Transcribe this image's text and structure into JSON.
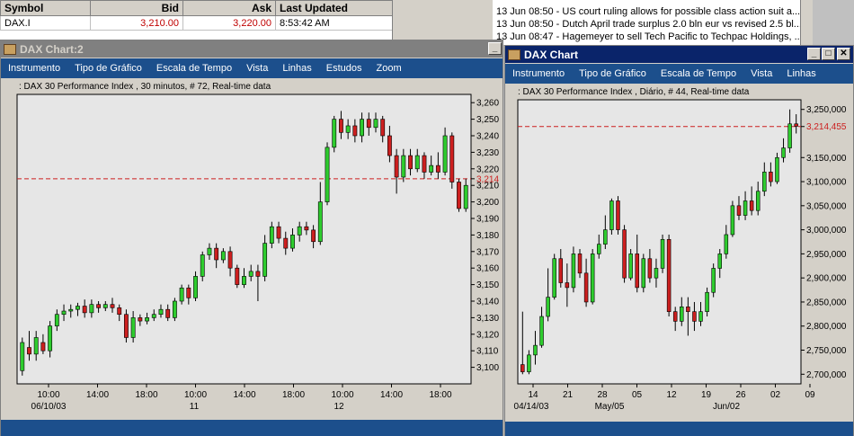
{
  "quotes": {
    "headers": {
      "symbol": "Symbol",
      "bid": "Bid",
      "ask": "Ask",
      "last_updated": "Last Updated"
    },
    "rows": [
      {
        "symbol": "DAX.I",
        "bid": "3,210.00",
        "ask": "3,220.00",
        "last_updated": "8:53:42 AM"
      }
    ]
  },
  "news": {
    "items": [
      "13 Jun 08:50 - US court ruling allows for possible class action suit a...",
      "13 Jun 08:50 - Dutch April trade surplus 2.0 bln eur vs revised 2.5 bl...",
      "13 Jun 08:47 - Hagemeyer to sell Tech Pacific to Techpac Holdings, ..."
    ]
  },
  "colors": {
    "menubar": "#1c4f8c",
    "up_candle": "#2ecc2e",
    "down_candle": "#cc1f1f",
    "last_line": "#cc1f1f"
  },
  "window_left": {
    "title": "DAX Chart:2",
    "menu": [
      "Instrumento",
      "Tipo de Gráfico",
      "Escala de Tempo",
      "Vista",
      "Linhas",
      "Estudos",
      "Zoom"
    ],
    "caption": ": DAX 30 Performance Index , 30 minutos, # 72, Real-time data",
    "chart_data": {
      "type": "candlestick",
      "ylim": [
        3090,
        3265
      ],
      "y_ticks": [
        "3,260",
        "3,250",
        "3,240",
        "3,230",
        "3,220",
        "3,214",
        "3,210",
        "3,200",
        "3,190",
        "3,180",
        "3,170",
        "3,160",
        "3,150",
        "3,140",
        "3,130",
        "3,120",
        "3,110",
        "3,100"
      ],
      "last_value": 3214,
      "last_label": "3,214",
      "x_tick_labels": [
        "10:00",
        "14:00",
        "18:00",
        "10:00",
        "14:00",
        "18:00",
        "10:00",
        "14:00",
        "18:00"
      ],
      "x_date_labels": [
        "06/10/03",
        "11",
        "12"
      ],
      "candles": [
        [
          3098,
          3115,
          3095,
          3118
        ],
        [
          3112,
          3108,
          3104,
          3122
        ],
        [
          3108,
          3118,
          3104,
          3122
        ],
        [
          3115,
          3110,
          3108,
          3120
        ],
        [
          3110,
          3125,
          3106,
          3128
        ],
        [
          3125,
          3132,
          3122,
          3135
        ],
        [
          3132,
          3134,
          3128,
          3138
        ],
        [
          3134,
          3135,
          3130,
          3138
        ],
        [
          3135,
          3137,
          3131,
          3139
        ],
        [
          3137,
          3133,
          3130,
          3141
        ],
        [
          3133,
          3138,
          3130,
          3141
        ],
        [
          3138,
          3136,
          3133,
          3140
        ],
        [
          3136,
          3138,
          3134,
          3140
        ],
        [
          3138,
          3136,
          3133,
          3142
        ],
        [
          3136,
          3132,
          3128,
          3138
        ],
        [
          3132,
          3118,
          3115,
          3135
        ],
        [
          3118,
          3130,
          3115,
          3134
        ],
        [
          3130,
          3128,
          3125,
          3132
        ],
        [
          3128,
          3130,
          3126,
          3133
        ],
        [
          3130,
          3132,
          3128,
          3135
        ],
        [
          3132,
          3135,
          3130,
          3138
        ],
        [
          3135,
          3130,
          3128,
          3138
        ],
        [
          3130,
          3140,
          3128,
          3142
        ],
        [
          3140,
          3148,
          3138,
          3150
        ],
        [
          3148,
          3142,
          3138,
          3150
        ],
        [
          3142,
          3155,
          3140,
          3158
        ],
        [
          3155,
          3168,
          3152,
          3170
        ],
        [
          3168,
          3172,
          3165,
          3175
        ],
        [
          3172,
          3165,
          3160,
          3175
        ],
        [
          3165,
          3170,
          3163,
          3172
        ],
        [
          3170,
          3160,
          3155,
          3173
        ],
        [
          3160,
          3150,
          3148,
          3162
        ],
        [
          3150,
          3155,
          3148,
          3160
        ],
        [
          3155,
          3158,
          3152,
          3162
        ],
        [
          3158,
          3155,
          3140,
          3162
        ],
        [
          3155,
          3175,
          3152,
          3180
        ],
        [
          3175,
          3185,
          3172,
          3188
        ],
        [
          3185,
          3178,
          3175,
          3188
        ],
        [
          3178,
          3172,
          3168,
          3182
        ],
        [
          3172,
          3180,
          3170,
          3184
        ],
        [
          3180,
          3185,
          3176,
          3188
        ],
        [
          3185,
          3183,
          3180,
          3188
        ],
        [
          3183,
          3176,
          3172,
          3186
        ],
        [
          3176,
          3200,
          3174,
          3212
        ],
        [
          3200,
          3233,
          3198,
          3236
        ],
        [
          3233,
          3250,
          3230,
          3252
        ],
        [
          3250,
          3242,
          3238,
          3255
        ],
        [
          3242,
          3246,
          3238,
          3250
        ],
        [
          3246,
          3240,
          3236,
          3250
        ],
        [
          3240,
          3250,
          3236,
          3254
        ],
        [
          3250,
          3245,
          3240,
          3254
        ],
        [
          3245,
          3250,
          3242,
          3254
        ],
        [
          3250,
          3240,
          3236,
          3252
        ],
        [
          3240,
          3228,
          3224,
          3246
        ],
        [
          3228,
          3215,
          3205,
          3232
        ],
        [
          3215,
          3228,
          3212,
          3232
        ],
        [
          3228,
          3220,
          3216,
          3232
        ],
        [
          3220,
          3228,
          3218,
          3232
        ],
        [
          3228,
          3218,
          3214,
          3230
        ],
        [
          3218,
          3222,
          3216,
          3228
        ],
        [
          3222,
          3218,
          3214,
          3230
        ],
        [
          3218,
          3240,
          3216,
          3245
        ],
        [
          3240,
          3212,
          3208,
          3242
        ],
        [
          3212,
          3196,
          3194,
          3214
        ],
        [
          3196,
          3210,
          3194,
          3214
        ]
      ]
    }
  },
  "window_right": {
    "title": "DAX Chart",
    "menu": [
      "Instrumento",
      "Tipo de Gráfico",
      "Escala de Tempo",
      "Vista",
      "Linhas"
    ],
    "caption": ": DAX 30 Performance Index , Diário, # 44, Real-time data",
    "chart_data": {
      "type": "candlestick",
      "ylim": [
        2680,
        3270
      ],
      "y_ticks": [
        "3,250,000",
        "3,214,455",
        "3,150,000",
        "3,100,000",
        "3,050,000",
        "3,000,000",
        "2,950,000",
        "2,900,000",
        "2,850,000",
        "2,800,000",
        "2,750,000",
        "2,700,000"
      ],
      "last_value": 3214.455,
      "last_label": "3,214,455",
      "x_tick_labels": [
        "14",
        "21",
        "28",
        "05",
        "12",
        "19",
        "26",
        "02",
        "09"
      ],
      "x_date_labels": [
        "04/14/03",
        "May/05",
        "Jun/02"
      ],
      "candles": [
        [
          2720,
          2705,
          2700,
          2830
        ],
        [
          2705,
          2740,
          2700,
          2750
        ],
        [
          2740,
          2760,
          2720,
          2790
        ],
        [
          2760,
          2820,
          2755,
          2840
        ],
        [
          2820,
          2860,
          2810,
          2920
        ],
        [
          2860,
          2940,
          2855,
          2950
        ],
        [
          2940,
          2890,
          2880,
          2960
        ],
        [
          2890,
          2880,
          2840,
          2930
        ],
        [
          2880,
          2950,
          2870,
          2965
        ],
        [
          2950,
          2910,
          2900,
          2960
        ],
        [
          2910,
          2850,
          2840,
          2940
        ],
        [
          2850,
          2950,
          2845,
          2960
        ],
        [
          2950,
          2970,
          2940,
          2990
        ],
        [
          2970,
          3000,
          2960,
          3030
        ],
        [
          3000,
          3060,
          2990,
          3065
        ],
        [
          3060,
          3000,
          2990,
          3070
        ],
        [
          3000,
          2900,
          2890,
          3010
        ],
        [
          2900,
          2950,
          2895,
          2960
        ],
        [
          2950,
          2880,
          2870,
          2990
        ],
        [
          2880,
          2940,
          2870,
          2950
        ],
        [
          2940,
          2900,
          2890,
          2960
        ],
        [
          2900,
          2920,
          2880,
          2940
        ],
        [
          2920,
          2980,
          2910,
          2990
        ],
        [
          2980,
          2830,
          2820,
          2990
        ],
        [
          2830,
          2810,
          2790,
          2840
        ],
        [
          2810,
          2840,
          2800,
          2860
        ],
        [
          2840,
          2830,
          2780,
          2860
        ],
        [
          2830,
          2810,
          2790,
          2850
        ],
        [
          2810,
          2830,
          2800,
          2850
        ],
        [
          2830,
          2870,
          2820,
          2880
        ],
        [
          2870,
          2920,
          2860,
          2930
        ],
        [
          2920,
          2950,
          2900,
          2960
        ],
        [
          2950,
          2990,
          2940,
          3010
        ],
        [
          2990,
          3050,
          2985,
          3060
        ],
        [
          3050,
          3030,
          3020,
          3070
        ],
        [
          3030,
          3060,
          3020,
          3080
        ],
        [
          3060,
          3040,
          3030,
          3090
        ],
        [
          3040,
          3080,
          3030,
          3100
        ],
        [
          3080,
          3120,
          3070,
          3140
        ],
        [
          3120,
          3100,
          3090,
          3140
        ],
        [
          3100,
          3150,
          3095,
          3160
        ],
        [
          3150,
          3170,
          3140,
          3190
        ],
        [
          3170,
          3220,
          3160,
          3250
        ],
        [
          3220,
          3215,
          3200,
          3240
        ]
      ]
    }
  }
}
